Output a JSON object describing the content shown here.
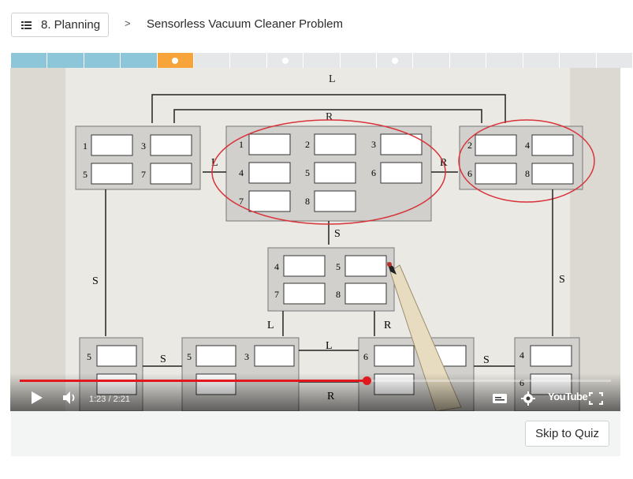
{
  "header": {
    "lesson_label": "8. Planning",
    "separator": ">",
    "title": "Sensorless Vacuum Cleaner Problem"
  },
  "progress": {
    "segments": 17,
    "completed": 4,
    "current_index": 4,
    "dots_at": [
      4,
      7,
      10
    ],
    "colors": {
      "done": "#8dc6d8",
      "current": "#f7a43a",
      "todo": "#e5e7e8"
    }
  },
  "video": {
    "time_display": "1:23 / 2:21",
    "progress_fraction": 0.587,
    "youtube_label": "YouTube",
    "diagram": {
      "top_action": "L",
      "second_action": "R",
      "left_action": "L",
      "right_action": "R",
      "suck_action": "S",
      "side_suck_left": "S",
      "side_suck_right": "S",
      "mid_left_action": "L",
      "mid_right_action": "R",
      "bottom_s_left": "S",
      "bottom_l": "L",
      "bottom_s_right": "S",
      "bottom_r": "R",
      "left_box_states": [
        "1",
        "3",
        "5",
        "7"
      ],
      "center_box_states": [
        "1",
        "2",
        "3",
        "4",
        "5",
        "6",
        "7",
        "8"
      ],
      "right_box_states": [
        "2",
        "4",
        "6",
        "8"
      ],
      "middle_box_states": [
        "4",
        "5",
        "7",
        "8"
      ],
      "bottom_states": [
        "5",
        "5",
        "3",
        "6",
        "4",
        "6"
      ]
    }
  },
  "footer": {
    "skip_label": "Skip to Quiz"
  }
}
